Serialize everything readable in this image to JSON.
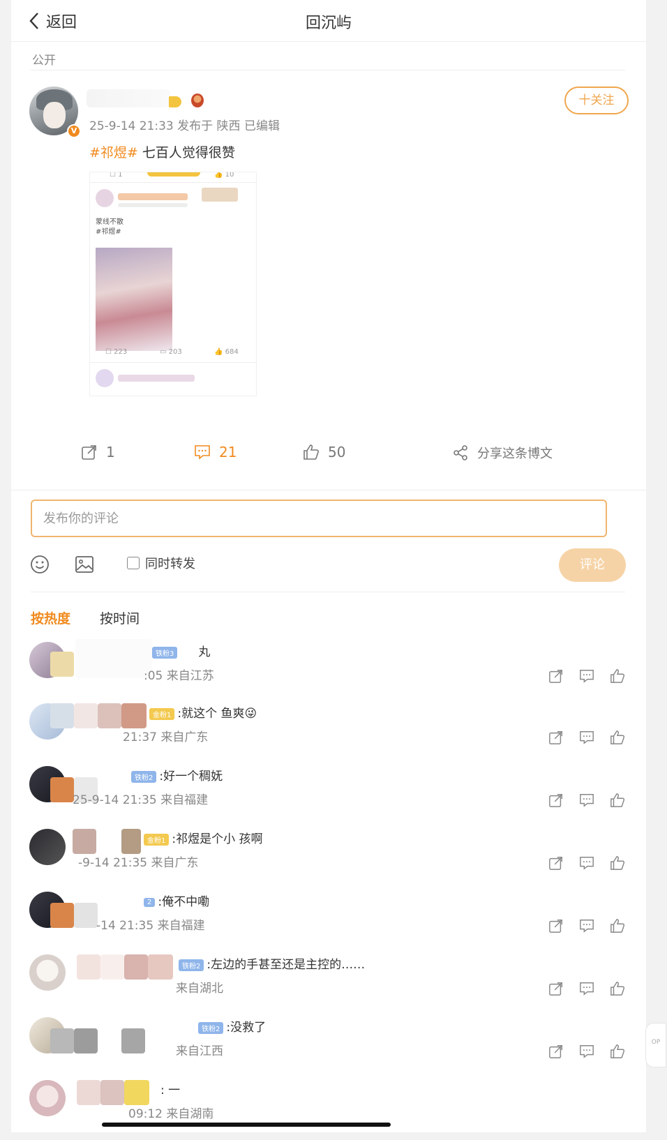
{
  "nav": {
    "back_label": "返回",
    "title": "回沉屿"
  },
  "post": {
    "visibility": "公开",
    "follow_label": "十关注",
    "verified_badge": "V",
    "meta": "25-9-14 21:33 发布于 陕西  已编辑",
    "hashtag": "#祁煜#",
    "text": " 七百人觉得很赞",
    "embedded_screenshot": {
      "top_repost": "1",
      "top_likes": "10",
      "post_line1": "蒙线不散",
      "post_line2": "#祁煜#",
      "reposts": "223",
      "comments": "203",
      "likes": "684"
    }
  },
  "actions": {
    "repost_count": "1",
    "comment_count": "21",
    "like_count": "50",
    "share_label": "分享这条博文"
  },
  "composer": {
    "placeholder": "发布你的评论",
    "repost_checkbox_label": "同时转发",
    "submit_label": "评论"
  },
  "sort": {
    "hot": "按热度",
    "time": "按时间"
  },
  "comments": [
    {
      "fan": "铁粉3",
      "text": "丸",
      "meta": ":05 来自江苏"
    },
    {
      "fan": "金粉1",
      "text": ":就这个     鱼爽😜",
      "meta": "21:37 来自广东"
    },
    {
      "fan": "铁粉2",
      "text": ":好一个稠妩",
      "meta": "25-9-14 21:35 来自福建"
    },
    {
      "fan": "金粉1",
      "text": ":祁煜是个小    孩啊",
      "meta": "-9-14 21:35 来自广东"
    },
    {
      "fan": "2",
      "text": ":俺不中嘞",
      "meta": "-14 21:35 来自福建"
    },
    {
      "fan": "铁粉2",
      "text": ":左边的手甚至还是主控的……",
      "meta": "来自湖北"
    },
    {
      "fan": "铁粉2",
      "text": ":没救了",
      "meta": "来自江西"
    },
    {
      "fan": "",
      "text": ":    一",
      "meta": "09:12 来自湖南"
    }
  ],
  "top_button_label": "OP"
}
